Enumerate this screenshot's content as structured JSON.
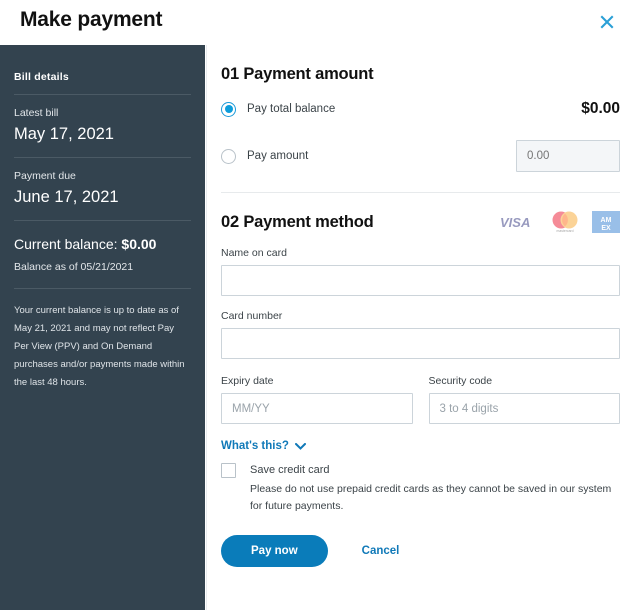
{
  "header": {
    "title": "Make payment",
    "close_icon": "close-icon"
  },
  "sidebar": {
    "heading": "Bill details",
    "blocks": [
      {
        "label": "Latest bill",
        "value": "May 17, 2021"
      },
      {
        "label": "Payment due",
        "value": "June 17, 2021"
      }
    ],
    "balance_label": "Current balance:",
    "balance_value": "$0.00",
    "balance_as_of": "Balance as of 05/21/2021",
    "note": "Your current balance is up to date as of May 21, 2021 and may not reflect Pay Per View (PPV) and On Demand purchases and/or payments made within the last 48 hours."
  },
  "payment_amount": {
    "section_title": "01 Payment amount",
    "option_total_label": "Pay total balance",
    "total_amount": "$0.00",
    "option_amount_label": "Pay amount",
    "amount_placeholder": "0.00",
    "amount_value": "",
    "selected": "total"
  },
  "payment_method": {
    "section_title": "02 Payment method",
    "card_logos": [
      "visa-logo",
      "mastercard-logo",
      "amex-logo"
    ],
    "visa_text": "VISA",
    "mastercard_text": "mastercard",
    "amex_line1": "AM",
    "amex_line2": "EX",
    "name_label": "Name on card",
    "name_placeholder": "",
    "name_value": "",
    "number_label": "Card number",
    "number_placeholder": "",
    "number_value": "",
    "expiry_label": "Expiry date",
    "expiry_placeholder": "MM/YY",
    "expiry_value": "",
    "security_label": "Security code",
    "security_placeholder": "3 to 4 digits",
    "security_value": "",
    "whats_this": "What's this?",
    "save_label": "Save credit card",
    "save_note": "Please do not use prepaid credit cards as they cannot be saved in our system for future payments."
  },
  "actions": {
    "pay_label": "Pay now",
    "cancel_label": "Cancel"
  },
  "colors": {
    "sidebar_bg": "#33434f",
    "accent_blue": "#0a7cba",
    "radio_blue": "#0d9ddb",
    "link_blue": "#1079b8"
  }
}
